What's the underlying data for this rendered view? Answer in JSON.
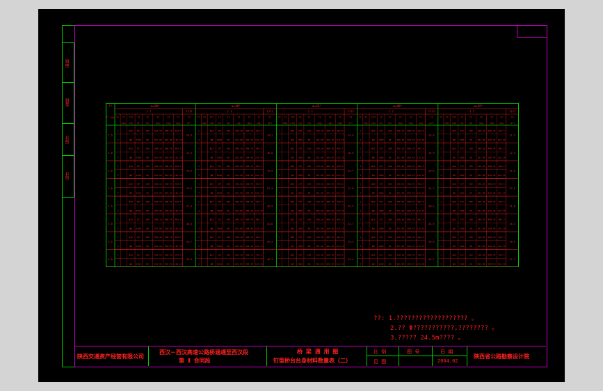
{
  "side_labels": [
    "审核",
    "复核",
    "设计",
    "设计"
  ],
  "table": {
    "header_left_top": "??",
    "header_left_bottom": "?? (m)",
    "groups": [
      {
        "title": "α=20°",
        "sub_left": "? ?",
        "sub_right": "????"
      },
      {
        "title": "α=30°",
        "sub_left": "? ?",
        "sub_right": "????"
      },
      {
        "title": "α=35°",
        "sub_left": "? ?",
        "sub_right": "????"
      },
      {
        "title": "α=40°",
        "sub_left": "? ?",
        "sub_right": "????"
      },
      {
        "title": "α=45°",
        "sub_left": "? ?",
        "sub_right": "????"
      }
    ],
    "col_heads": [
      "??",
      "??",
      "???",
      "??",
      "??",
      "??",
      "??",
      "??",
      "??"
    ],
    "unit_heads": [
      "",
      "(mm)",
      "(cm)",
      "(m)",
      "(m)",
      "(kg)",
      "(kg)",
      "(kg)",
      "(m³)"
    ],
    "heights": [
      "2.5",
      "3.0",
      "3.5",
      "4.0",
      "4.5",
      "5.0",
      "5.5",
      "6.0"
    ],
    "row_a": [
      "1",
      "φ12",
      "337",
      "100",
      "348.10",
      "408.76",
      "442.5"
    ],
    "row_b": [
      "2",
      "φ8",
      "1560",
      "80",
      "201.90",
      "204.45",
      "116.33"
    ],
    "volumes": [
      [
        "10.9",
        "13.2",
        "14.0",
        "13.6",
        "11.5"
      ],
      [
        "15.5",
        "16.0",
        "16.6",
        "15.9",
        "12.5"
      ],
      [
        "18.6",
        "19.9",
        "20.4",
        "19.6",
        "21.0"
      ],
      [
        "19.5",
        "21.3",
        "22.8",
        "24.7",
        "27.6"
      ],
      [
        "27.0",
        "28.5",
        "29.5",
        "30.2",
        "31.6"
      ],
      [
        "30.6",
        "31.6",
        "33.7",
        "34.9",
        "35.4"
      ],
      [
        "33.7",
        "34.3",
        "35.3",
        "36.6",
        "40.0"
      ],
      [
        "38.6",
        "40.3",
        "43.4",
        "45.2",
        "47.7"
      ]
    ]
  },
  "notes": {
    "label": "??:",
    "line1": "1.???????????????????     。",
    "line2": "2.?? Φ???????????,????????      。",
    "line3": "3.????? 24.5m???? 。"
  },
  "title_block": {
    "company": "陕西交通资产经营有限公司",
    "project_line1": "西汉－西汉高速公路桥涵通至西汉段",
    "project_line2": "第 Ⅱ 合同段",
    "drawing_line1": "桥 梁 通 用 图",
    "drawing_line2": "钉型桥台台身材料数量表（二）",
    "ratio_label": "比 例",
    "drawing_no_label": "图 号",
    "date_label": "日 期",
    "see_label": "见 图",
    "date_value": "2004.02",
    "institute": "陕西省公路勘察设计院"
  },
  "colors": {
    "bg": "#000000",
    "outer": "#d4d4d4",
    "line": "#ff2020",
    "frame_inner": "#c800c8",
    "frame_outer": "#00c800"
  }
}
